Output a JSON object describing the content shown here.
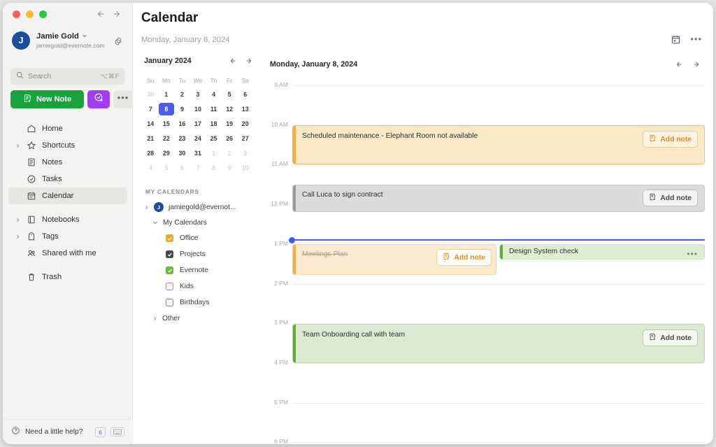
{
  "window": {
    "traffic_lights": [
      "close",
      "minimize",
      "maximize"
    ],
    "back_arrow": "back-arrow",
    "forward_arrow": "forward-arrow"
  },
  "sidebar": {
    "account": {
      "initial": "J",
      "name": "Jamie Gold",
      "email": "jamiegold@evernote.com",
      "chevron": "chevron-down-icon",
      "settings_icon": "gear-icon"
    },
    "search": {
      "placeholder": "Search",
      "shortcut": "⌥⌘F",
      "icon": "search-icon"
    },
    "actions": {
      "new_note_label": "New Note",
      "new_note_icon": "note-plus-icon",
      "task_icon": "task-check-plus-icon",
      "more_label": "•••"
    },
    "nav_items": [
      {
        "label": "Home",
        "icon": "home-icon",
        "expandable": false,
        "active": false
      },
      {
        "label": "Shortcuts",
        "icon": "star-icon",
        "expandable": true,
        "active": false
      },
      {
        "label": "Notes",
        "icon": "note-icon",
        "expandable": false,
        "active": false
      },
      {
        "label": "Tasks",
        "icon": "check-circle-icon",
        "expandable": false,
        "active": false
      },
      {
        "label": "Calendar",
        "icon": "calendar-icon",
        "expandable": false,
        "active": true
      },
      {
        "label": "Notebooks",
        "icon": "notebook-icon",
        "expandable": true,
        "active": false
      },
      {
        "label": "Tags",
        "icon": "tag-icon",
        "expandable": true,
        "active": false
      },
      {
        "label": "Shared with me",
        "icon": "people-icon",
        "expandable": false,
        "active": false
      },
      {
        "label": "Trash",
        "icon": "trash-icon",
        "expandable": false,
        "active": false
      }
    ],
    "help": {
      "label": "Need a little help?",
      "icon": "question-circle-icon",
      "badge": "6",
      "keyboard_icon": "keyboard-icon"
    }
  },
  "header": {
    "title": "Calendar",
    "subtitle": "Monday, January 8, 2024",
    "calendar_icon": "calendar-day-icon",
    "more_icon": "ellipsis-icon"
  },
  "mini_calendar": {
    "month_label": "January 2024",
    "prev_icon": "arrow-left-icon",
    "next_icon": "arrow-right-icon",
    "day_names": [
      "Su",
      "Mo",
      "Tu",
      "We",
      "Th",
      "Fr",
      "Sa"
    ],
    "weeks": [
      [
        {
          "d": "30",
          "m": true
        },
        {
          "d": "1"
        },
        {
          "d": "2"
        },
        {
          "d": "3"
        },
        {
          "d": "4"
        },
        {
          "d": "5"
        },
        {
          "d": "6"
        }
      ],
      [
        {
          "d": "7"
        },
        {
          "d": "8",
          "sel": true
        },
        {
          "d": "9"
        },
        {
          "d": "10"
        },
        {
          "d": "11"
        },
        {
          "d": "12"
        },
        {
          "d": "13"
        }
      ],
      [
        {
          "d": "14"
        },
        {
          "d": "15"
        },
        {
          "d": "16"
        },
        {
          "d": "17"
        },
        {
          "d": "18"
        },
        {
          "d": "19"
        },
        {
          "d": "20"
        }
      ],
      [
        {
          "d": "21"
        },
        {
          "d": "22"
        },
        {
          "d": "23"
        },
        {
          "d": "24"
        },
        {
          "d": "25"
        },
        {
          "d": "26"
        },
        {
          "d": "27"
        }
      ],
      [
        {
          "d": "28"
        },
        {
          "d": "29"
        },
        {
          "d": "30"
        },
        {
          "d": "31"
        },
        {
          "d": "1",
          "m": true
        },
        {
          "d": "2",
          "m": true
        },
        {
          "d": "3",
          "m": true
        }
      ],
      [
        {
          "d": "4",
          "m": true
        },
        {
          "d": "5",
          "m": true
        },
        {
          "d": "6",
          "m": true
        },
        {
          "d": "7",
          "m": true
        },
        {
          "d": "8",
          "m": true
        },
        {
          "d": "9",
          "m": true
        },
        {
          "d": "10",
          "m": true
        }
      ]
    ]
  },
  "my_calendars": {
    "section_title": "MY CALENDARS",
    "account_row": {
      "label": "jamiegold@evernot...",
      "initial": "J",
      "chevron": "chevron-right-icon"
    },
    "group_row": {
      "label": "My Calendars",
      "chevron": "chevron-down-icon"
    },
    "calendars": [
      {
        "label": "Office",
        "color": "#f5a623",
        "checked": true
      },
      {
        "label": "Projects",
        "color": "#4a4a4a",
        "checked": true
      },
      {
        "label": "Evernote",
        "color": "#63c132",
        "checked": true
      },
      {
        "label": "Kids",
        "color": "#b97fe0",
        "checked": false
      },
      {
        "label": "Birthdays",
        "color": "#e8596e",
        "checked": false
      }
    ],
    "other_row": {
      "label": "Other",
      "chevron": "chevron-right-icon"
    }
  },
  "day_view": {
    "title": "Monday, January 8, 2024",
    "prev_icon": "arrow-left-icon",
    "next_icon": "arrow-right-icon",
    "hours": [
      "9 AM",
      "10 AM",
      "11 AM",
      "12 PM",
      "1 PM",
      "2 PM",
      "3 PM",
      "4 PM",
      "5 PM",
      "6 PM"
    ],
    "now_indicator": {
      "label": "current-time",
      "position_hour": "12:50 PM"
    },
    "add_note_label": "Add note",
    "add_note_icon": "note-plus-icon",
    "events": [
      {
        "title": "Scheduled maintenance - Elephant Room not available",
        "start": "10 AM",
        "end": "11 AM",
        "bg": "#fbe8c4",
        "bar": "#edb14a",
        "border": "#edc078",
        "text_color": "#2f2f31",
        "has_add_note": true,
        "add_note_color": "#e08a16",
        "add_note_bg": "#fdf3e0",
        "add_note_border": "#eecf9b",
        "done": false,
        "full_width": true
      },
      {
        "title": "Call Luca to sign contract",
        "start": "11:30 AM",
        "end": "12:10 PM",
        "bg": "#dbdbdb",
        "bar": "#9a9a9a",
        "border": "#c9c9c9",
        "text_color": "#2f2f31",
        "has_add_note": true,
        "add_note_color": "#4a4a4a",
        "add_note_bg": "#f3f3f3",
        "add_note_border": "#c4c4c4",
        "done": false,
        "full_width": true
      },
      {
        "title": "Meetings Plan",
        "start": "1 PM",
        "end": "1:40 PM",
        "bg": "#fbead0",
        "bar": "#edb14a",
        "border": "#f0d6a8",
        "text_color": "#a9a29a",
        "has_add_note": true,
        "add_note_color": "#e08a16",
        "add_note_bg": "#ffffff",
        "add_note_border": "#eecf9b",
        "done": true,
        "full_width": false
      },
      {
        "title": "Design System check",
        "start": "1 PM",
        "end": "1:20 PM",
        "bg": "#dfeed3",
        "bar": "#5faa3a",
        "border": "#cfe3bd",
        "text_color": "#2f2f31",
        "has_add_note": false,
        "menu_icon": "ellipsis-icon",
        "menu_color": "#6a9c4a",
        "done": false,
        "full_width": false
      },
      {
        "title": "Team Onboarding call with team",
        "start": "3 PM",
        "end": "4 PM",
        "bg": "#dde9d1",
        "bar": "#5faa3a",
        "border": "#c5d8b4",
        "text_color": "#2f2f31",
        "has_add_note": true,
        "add_note_color": "#4a4a4a",
        "add_note_bg": "#f4f8f0",
        "add_note_border": "#b9cfa8",
        "done": false,
        "full_width": true
      }
    ]
  },
  "colors": {
    "accent_green": "#18a33f",
    "accent_purple": "#a33bf0",
    "selected_blue": "#4a5ce8",
    "now_blue": "#3d5afe",
    "sidebar_bg": "#f3f3f1"
  }
}
